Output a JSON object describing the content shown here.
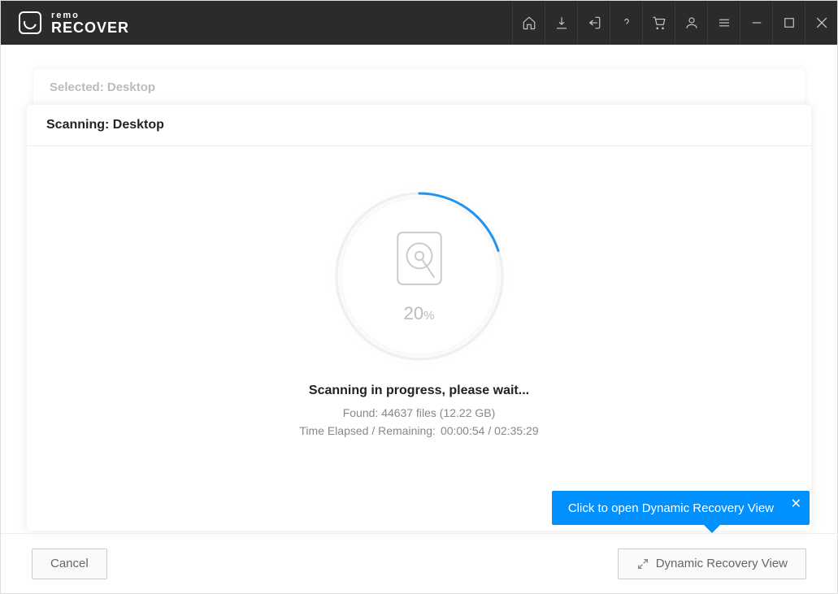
{
  "app": {
    "brand_small": "remo",
    "brand_big": "RECOVER"
  },
  "back_card": {
    "title": "Selected: Desktop"
  },
  "front_card": {
    "title": "Scanning: Desktop"
  },
  "scan": {
    "percent_value": 20,
    "percent_text": "20",
    "percent_suffix": "%",
    "status": "Scanning in progress, please wait...",
    "found_text": "Found: 44637 files (12.22 GB)",
    "time_label": "Time Elapsed / Remaining:",
    "time_value": "00:00:54 / 02:35:29"
  },
  "buttons": {
    "cancel": "Cancel",
    "dynamic": "Dynamic Recovery View"
  },
  "tooltip": {
    "text": "Click to open Dynamic Recovery View"
  }
}
